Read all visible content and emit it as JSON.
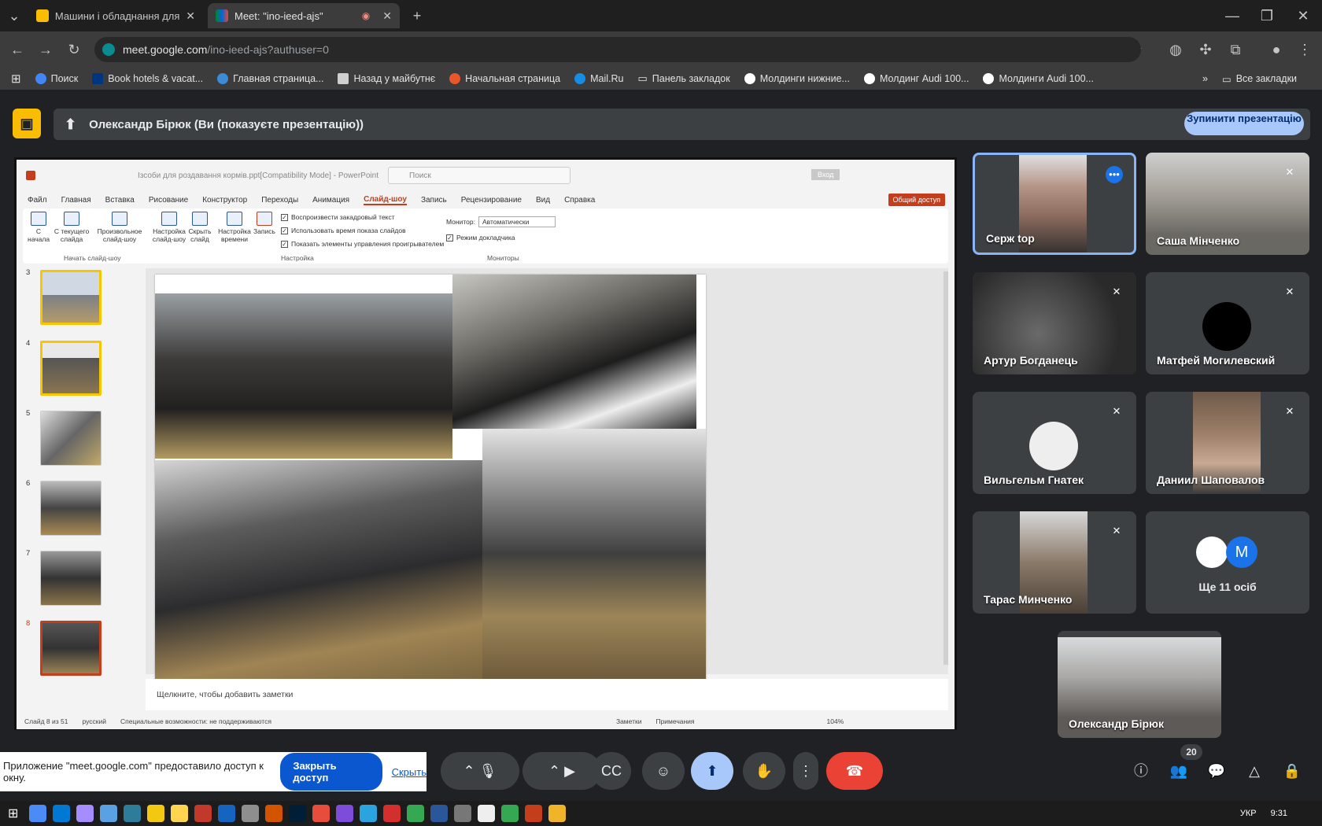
{
  "browser": {
    "tabs": [
      {
        "title": "Машини і обладнання для тва",
        "active": false
      },
      {
        "title": "Meet: \"ino-ieed-ajs\"",
        "active": true
      }
    ],
    "url_host": "meet.google.com",
    "url_path": "/ino-ieed-ajs?authuser=0",
    "bookmarks": [
      "Поиск",
      "Book hotels & vacat...",
      "Главная страница...",
      "Назад у майбутнє",
      "Начальная страница",
      "Mail.Ru",
      "Панель закладок",
      "Молдинги нижние...",
      "Молдинг Audi 100...",
      "Молдинги Audi 100..."
    ],
    "all_bookmarks": "Все закладки"
  },
  "meet": {
    "presenting_text": "Олександр Бірюк (Ви (показуєте презентацію))",
    "stop_label": "Зупинити презентацію",
    "participants": [
      {
        "name": "Серж top",
        "muted": false,
        "active": true
      },
      {
        "name": "Саша Мінченко",
        "muted": true
      },
      {
        "name": "Артур Богданець",
        "muted": true
      },
      {
        "name": "Матфей Могилевский",
        "muted": true
      },
      {
        "name": "Вильгельм Гнатек",
        "muted": true
      },
      {
        "name": "Даниил Шаповалов",
        "muted": true
      },
      {
        "name": "Тарас Минченко",
        "muted": true
      }
    ],
    "more_people": "Ще 11 осіб",
    "more_avatar_letter": "M",
    "self_name": "Олександр Бірюк",
    "participant_count": "20",
    "notification_text": "Приложение \"meet.google.com\" предоставило доступ к окну.",
    "close_access": "Закрыть доступ",
    "hide": "Скрыть"
  },
  "powerpoint": {
    "file_title": "Ізсоби для роздавання кормів.ppt[Compatibility Mode] - PowerPoint",
    "search_placeholder": "Поиск",
    "signin": "Вход",
    "share": "Общий доступ",
    "menu": [
      "Файл",
      "Главная",
      "Вставка",
      "Рисование",
      "Конструктор",
      "Переходы",
      "Анимация",
      "Слайд-шоу",
      "Запись",
      "Рецензирование",
      "Вид",
      "Справка"
    ],
    "selected_menu": "Слайд-шоу",
    "ribbon": {
      "from_start": "С начала",
      "from_current": "С текущего слайда",
      "custom": "Произвольное слайд-шоу",
      "setup": "Настройка слайд-шоу",
      "hide": "Скрыть слайд",
      "rehearse": "Настройка времени",
      "record": "Запись",
      "play_narration": "Воспроизвести закадровый текст",
      "use_timings": "Использовать время показа слайдов",
      "show_controls": "Показать элементы управления проигрывателем",
      "monitor_label": "Монитор:",
      "monitor_value": "Автоматически",
      "presenter_view": "Режим докладчика",
      "group_start": "Начать слайд-шоу",
      "group_setup": "Настройка",
      "group_monitors": "Мониторы"
    },
    "slide_numbers": [
      "3",
      "4",
      "5",
      "6",
      "7",
      "8"
    ],
    "notes_placeholder": "Щелкните, чтобы добавить заметки",
    "status": {
      "slide": "Слайд 8 из 51",
      "lang": "русский",
      "accessibility": "Специальные возможности: не поддерживаются",
      "notes": "Заметки",
      "comments": "Примечания",
      "zoom": "104%"
    }
  },
  "taskbar": {
    "lang": "УКР",
    "time": "9:31"
  }
}
